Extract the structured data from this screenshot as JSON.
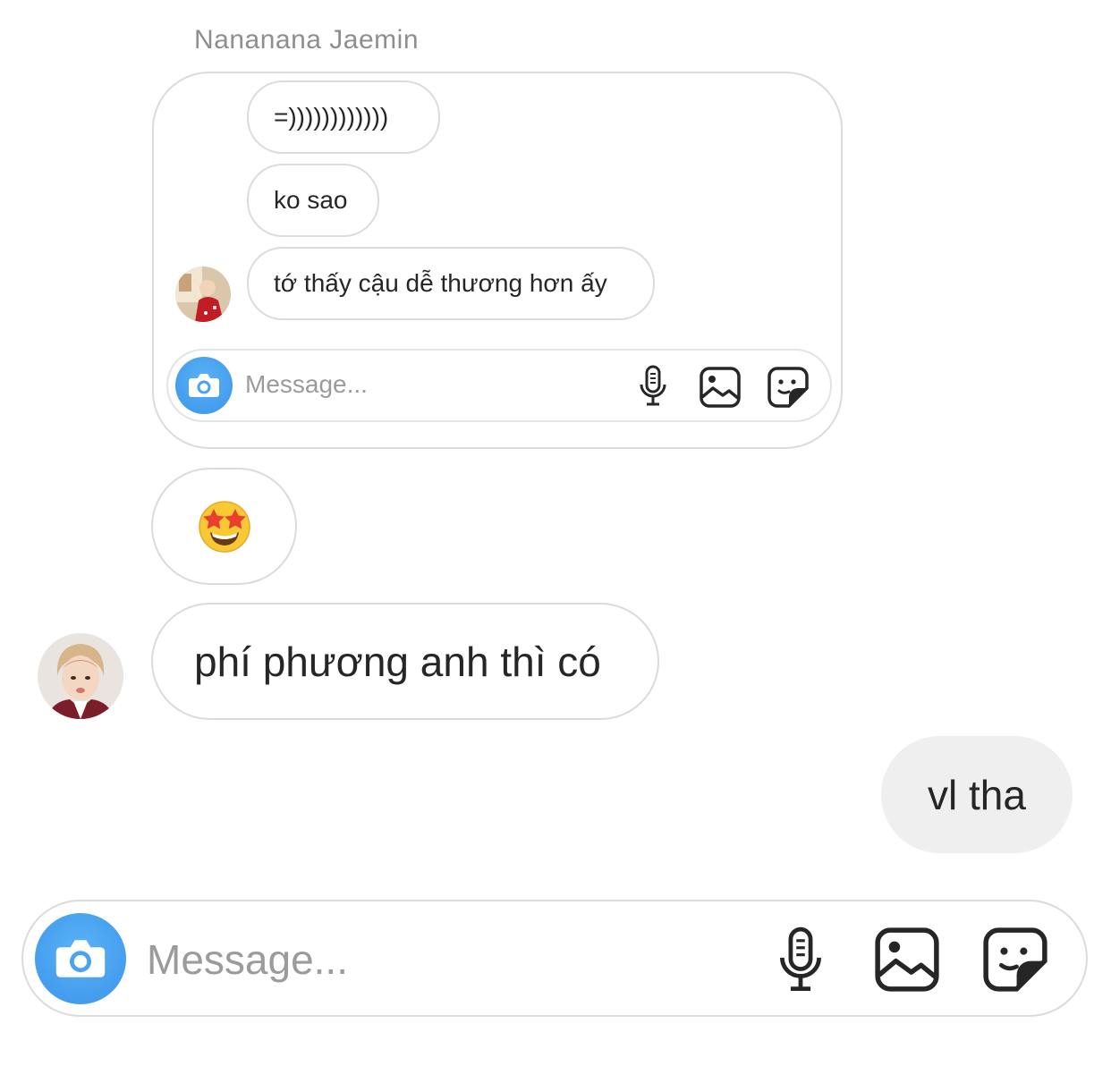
{
  "thread": {
    "sender_name": "Nananana Jaemin"
  },
  "quoted_card": {
    "messages": [
      {
        "text": "=))))))))))))"
      },
      {
        "text": "ko sao"
      },
      {
        "text": "tớ thấy cậu dễ thương hơn ấy"
      }
    ],
    "composer": {
      "placeholder": "Message...",
      "icons": [
        "camera-icon",
        "microphone-icon",
        "gallery-icon",
        "sticker-icon"
      ]
    }
  },
  "messages": [
    {
      "type": "emoji",
      "emoji": "🤩",
      "direction": "received"
    },
    {
      "type": "text",
      "text": "phí phương anh thì có",
      "direction": "received"
    },
    {
      "type": "text",
      "text": "vl tha",
      "direction": "sent"
    }
  ],
  "composer": {
    "placeholder": "Message...",
    "icons": [
      "camera-icon",
      "microphone-icon",
      "gallery-icon",
      "sticker-icon"
    ]
  },
  "colors": {
    "accent_blue": "#3b94ea",
    "bubble_border": "#dbdbdb",
    "sent_bubble": "#efefef",
    "placeholder": "#9b9b9b"
  }
}
